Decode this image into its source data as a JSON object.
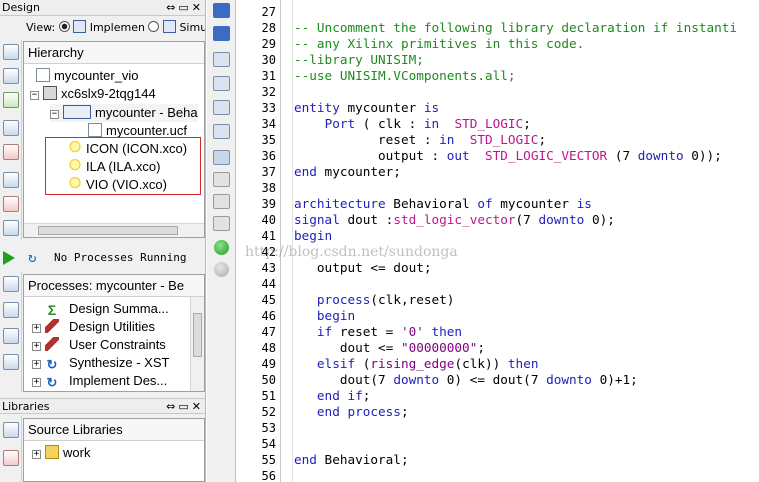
{
  "design_panel": {
    "title": "Design",
    "view_label": "View:",
    "view_implementation": "Implemen",
    "view_simulation": "Simu",
    "hierarchy_header": "Hierarchy",
    "tree": [
      {
        "label": "mycounter_vio"
      },
      {
        "label": "xc6slx9-2tqg144"
      },
      {
        "label": "mycounter - Beha"
      },
      {
        "label": "mycounter.ucf"
      },
      {
        "label": "ICON (ICON.xco)"
      },
      {
        "label": "ILA (ILA.xco)"
      },
      {
        "label": "VIO (VIO.xco)"
      }
    ],
    "status": "No Processes Running",
    "processes_header": "Processes: mycounter - Be",
    "processes": [
      {
        "label": "Design Summa..."
      },
      {
        "label": "Design Utilities"
      },
      {
        "label": "User Constraints"
      },
      {
        "label": "Synthesize - XST"
      },
      {
        "label": "Implement Des..."
      }
    ]
  },
  "libraries_panel": {
    "title": "Libraries",
    "header": "Source Libraries",
    "items": [
      {
        "label": "work"
      }
    ]
  },
  "watermark": "http://blog.csdn.net/sundonga",
  "editor": {
    "first_line": 27,
    "lines": [
      {
        "n": "27",
        "segs": []
      },
      {
        "n": "28",
        "segs": [
          {
            "c": "cm",
            "t": "-- Uncomment the following library declaration if instanti"
          }
        ]
      },
      {
        "n": "29",
        "segs": [
          {
            "c": "cm",
            "t": "-- any Xilinx primitives in this code."
          }
        ]
      },
      {
        "n": "30",
        "segs": [
          {
            "c": "cm",
            "t": "--library UNISIM;"
          }
        ]
      },
      {
        "n": "31",
        "segs": [
          {
            "c": "cm",
            "t": "--use UNISIM.VComponents.all;"
          }
        ]
      },
      {
        "n": "32",
        "segs": []
      },
      {
        "n": "33",
        "segs": [
          {
            "c": "kw",
            "t": "entity"
          },
          {
            "c": "",
            "t": " mycounter "
          },
          {
            "c": "kw",
            "t": "is"
          }
        ]
      },
      {
        "n": "34",
        "segs": [
          {
            "c": "",
            "t": "    "
          },
          {
            "c": "kw",
            "t": "Port"
          },
          {
            "c": "",
            "t": " ( clk : "
          },
          {
            "c": "kw",
            "t": "in"
          },
          {
            "c": "",
            "t": "  "
          },
          {
            "c": "ty",
            "t": "STD_LOGIC"
          },
          {
            "c": "",
            "t": ";"
          }
        ]
      },
      {
        "n": "35",
        "segs": [
          {
            "c": "",
            "t": "           reset : "
          },
          {
            "c": "kw",
            "t": "in"
          },
          {
            "c": "",
            "t": "  "
          },
          {
            "c": "ty",
            "t": "STD_LOGIC"
          },
          {
            "c": "",
            "t": ";"
          }
        ]
      },
      {
        "n": "36",
        "segs": [
          {
            "c": "",
            "t": "           output : "
          },
          {
            "c": "kw",
            "t": "out"
          },
          {
            "c": "",
            "t": "  "
          },
          {
            "c": "ty",
            "t": "STD_LOGIC_VECTOR"
          },
          {
            "c": "",
            "t": " (7 "
          },
          {
            "c": "kw",
            "t": "downto"
          },
          {
            "c": "",
            "t": " 0));"
          }
        ]
      },
      {
        "n": "37",
        "segs": [
          {
            "c": "kw",
            "t": "end"
          },
          {
            "c": "",
            "t": " mycounter;"
          }
        ]
      },
      {
        "n": "38",
        "segs": []
      },
      {
        "n": "39",
        "segs": [
          {
            "c": "kw",
            "t": "architecture"
          },
          {
            "c": "",
            "t": " Behavioral "
          },
          {
            "c": "kw",
            "t": "of"
          },
          {
            "c": "",
            "t": " mycounter "
          },
          {
            "c": "kw",
            "t": "is"
          }
        ]
      },
      {
        "n": "40",
        "segs": [
          {
            "c": "kw",
            "t": "signal"
          },
          {
            "c": "",
            "t": " dout :"
          },
          {
            "c": "ty",
            "t": "std_logic_vector"
          },
          {
            "c": "",
            "t": "(7 "
          },
          {
            "c": "kw",
            "t": "downto"
          },
          {
            "c": "",
            "t": " 0);"
          }
        ]
      },
      {
        "n": "41",
        "segs": [
          {
            "c": "kw",
            "t": "begin"
          }
        ]
      },
      {
        "n": "42",
        "segs": []
      },
      {
        "n": "43",
        "segs": [
          {
            "c": "",
            "t": "   output <= dout;"
          }
        ]
      },
      {
        "n": "44",
        "segs": []
      },
      {
        "n": "45",
        "segs": [
          {
            "c": "",
            "t": "   "
          },
          {
            "c": "kw",
            "t": "process"
          },
          {
            "c": "",
            "t": "(clk,reset)"
          }
        ]
      },
      {
        "n": "46",
        "segs": [
          {
            "c": "",
            "t": "   "
          },
          {
            "c": "kw",
            "t": "begin"
          }
        ]
      },
      {
        "n": "47",
        "segs": [
          {
            "c": "",
            "t": "   "
          },
          {
            "c": "kw",
            "t": "if"
          },
          {
            "c": "",
            "t": " reset = "
          },
          {
            "c": "st",
            "t": "'0'"
          },
          {
            "c": "",
            "t": " "
          },
          {
            "c": "kw",
            "t": "then"
          }
        ]
      },
      {
        "n": "48",
        "segs": [
          {
            "c": "",
            "t": "      dout <= "
          },
          {
            "c": "st",
            "t": "\"00000000\""
          },
          {
            "c": "",
            "t": ";"
          }
        ]
      },
      {
        "n": "49",
        "segs": [
          {
            "c": "",
            "t": "   "
          },
          {
            "c": "kw",
            "t": "elsif"
          },
          {
            "c": "",
            "t": " ("
          },
          {
            "c": "fn",
            "t": "rising_edge"
          },
          {
            "c": "",
            "t": "(clk)) "
          },
          {
            "c": "kw",
            "t": "then"
          }
        ]
      },
      {
        "n": "50",
        "segs": [
          {
            "c": "",
            "t": "      dout(7 "
          },
          {
            "c": "kw",
            "t": "downto"
          },
          {
            "c": "",
            "t": " 0) <= dout(7 "
          },
          {
            "c": "kw",
            "t": "downto"
          },
          {
            "c": "",
            "t": " 0)+1;"
          }
        ]
      },
      {
        "n": "51",
        "segs": [
          {
            "c": "",
            "t": "   "
          },
          {
            "c": "kw",
            "t": "end if"
          },
          {
            "c": "",
            "t": ";"
          }
        ]
      },
      {
        "n": "52",
        "segs": [
          {
            "c": "",
            "t": "   "
          },
          {
            "c": "kw",
            "t": "end process"
          },
          {
            "c": "",
            "t": ";"
          }
        ]
      },
      {
        "n": "53",
        "segs": []
      },
      {
        "n": "54",
        "segs": []
      },
      {
        "n": "55",
        "segs": [
          {
            "c": "kw",
            "t": "end"
          },
          {
            "c": "",
            "t": " Behavioral;"
          }
        ]
      },
      {
        "n": "56",
        "segs": []
      }
    ]
  }
}
